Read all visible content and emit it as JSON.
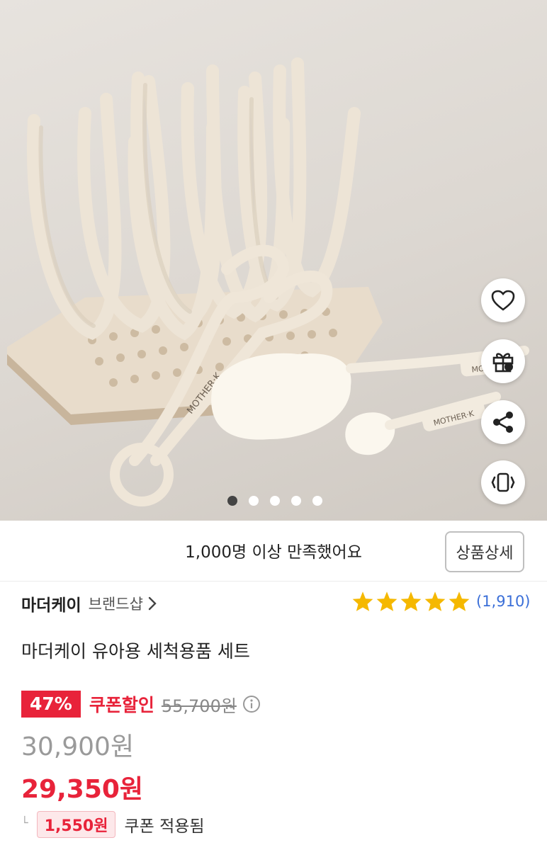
{
  "gallery": {
    "brand_marks": [
      "MOTHER·K",
      "MOTHER·K",
      "MOTHER·K"
    ],
    "indicator_count": 5,
    "active_index": 0
  },
  "actions": [
    {
      "name": "favorite",
      "icon": "heart-icon"
    },
    {
      "name": "gift",
      "icon": "gift-icon"
    },
    {
      "name": "share",
      "icon": "share-icon"
    },
    {
      "name": "vibrate",
      "icon": "vibrate-phone-icon"
    }
  ],
  "satisfaction": {
    "text": "1,000명 이상 만족했어요",
    "detail_button": "상품상세"
  },
  "brand": {
    "name": "마더케이",
    "shop_link": "브랜드샵"
  },
  "rating": {
    "stars": 5,
    "count": "(1,910)",
    "star_color": "#f5b800"
  },
  "product": {
    "title": "마더케이 유아용 세척용품 세트",
    "discount_rate": "47%",
    "coupon_discount_label": "쿠폰할인",
    "original_price": "55,700원",
    "sale_price": "30,900원",
    "coupon_price": "29,350원",
    "coupon_amount": "1,550원",
    "coupon_applied": "쿠폰 적용됨"
  },
  "colors": {
    "accent_red": "#e8233a",
    "link_blue": "#3b6fd8"
  }
}
